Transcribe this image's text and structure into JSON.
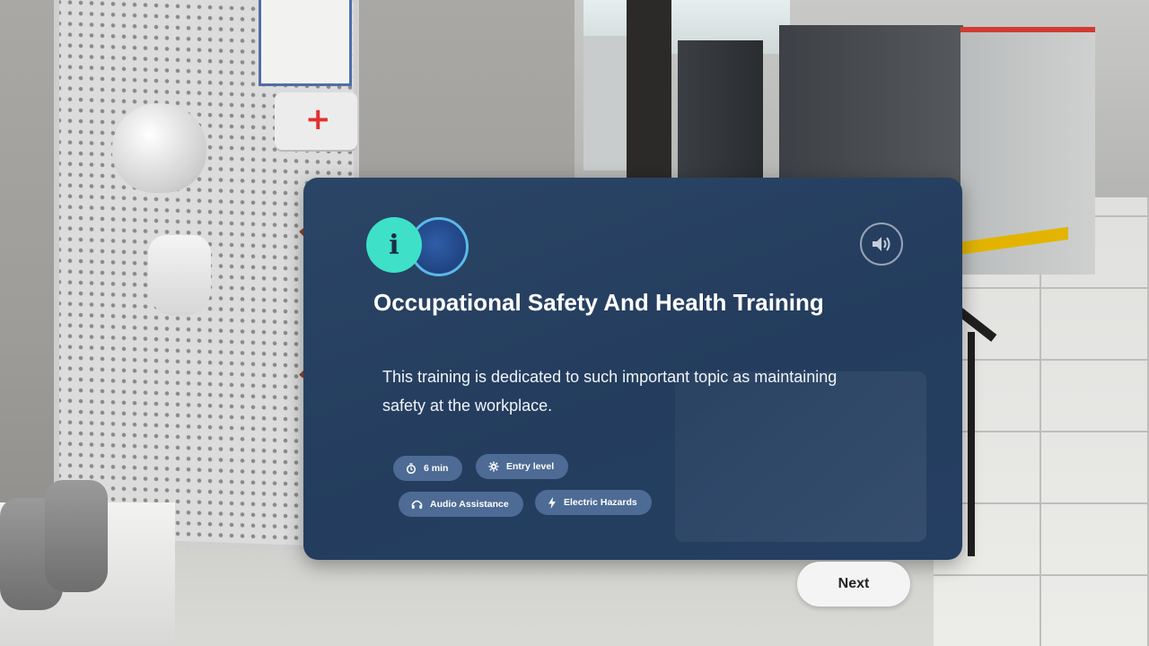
{
  "panel": {
    "title": "Occupational Safety And Health Training",
    "description": "This training is dedicated to such important topic as maintaining safety at the workplace.",
    "logo_letter": "i",
    "audio_icon": "speaker-icon",
    "chips": [
      {
        "label": "6 min",
        "icon": "timer-icon"
      },
      {
        "label": "Entry level",
        "icon": "gear-icon"
      },
      {
        "label": "Audio Assistance",
        "icon": "headphones-icon"
      },
      {
        "label": "Electric Hazards",
        "icon": "lightning-icon"
      }
    ]
  },
  "next_button": {
    "label": "Next"
  },
  "colors": {
    "panel_bg": "#2b4566",
    "chip_bg": "#4d6b94",
    "logo_accent": "#3ee0c8",
    "button_bg": "#f4f4f4"
  }
}
